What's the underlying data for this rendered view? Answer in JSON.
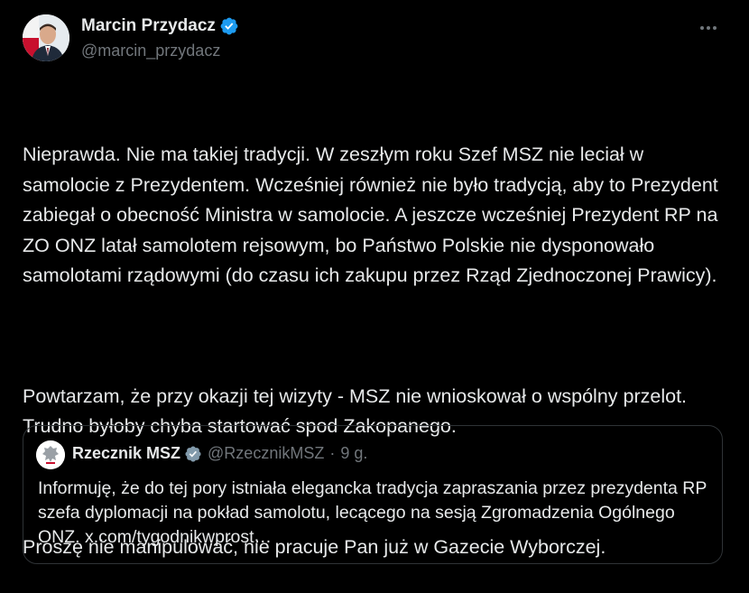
{
  "author": {
    "name": "Marcin Przydacz",
    "handle": "@marcin_przydacz"
  },
  "tweet": {
    "paragraphs": [
      "Nieprawda. Nie ma takiej tradycji. W zeszłym roku Szef MSZ nie leciał w samolocie z Prezydentem. Wcześniej również nie było tradycją, aby to Prezydent zabiegał o obecność Ministra w samolocie. A jeszcze wcześniej Prezydent RP na ZO ONZ latał samolotem rejsowym, bo Państwo Polskie nie dysponowało samolotami rządowymi (do czasu ich zakupu przez Rząd Zjednoczonej Prawicy).",
      "Powtarzam, że przy okazji tej wizyty - MSZ nie wnioskował o wspólny przelot. Trudno byłoby chyba startować spod Zakopanego.",
      "Proszę nie manipulować, nie pracuje Pan już w Gazecie Wyborczej."
    ]
  },
  "quoted": {
    "name": "Rzecznik MSZ",
    "handle": "@RzecznikMSZ",
    "separator": "·",
    "time": "9 g.",
    "text": "Informuję, że do tej pory istniała elegancka tradycja zapraszania przez prezydenta RP szefa dyplomacji na pokład samolotu, lecącego na sesją Zgromadzenia Ogólnego ONZ. x.com/tygodnikwprost…"
  },
  "colors": {
    "background": "#000000",
    "text": "#e7e9ea",
    "secondary": "#71767b",
    "verified": "#1d9bf0",
    "border": "#2f3336"
  },
  "icons": {
    "verified": "verified-badge-icon",
    "more": "more-options-icon"
  }
}
